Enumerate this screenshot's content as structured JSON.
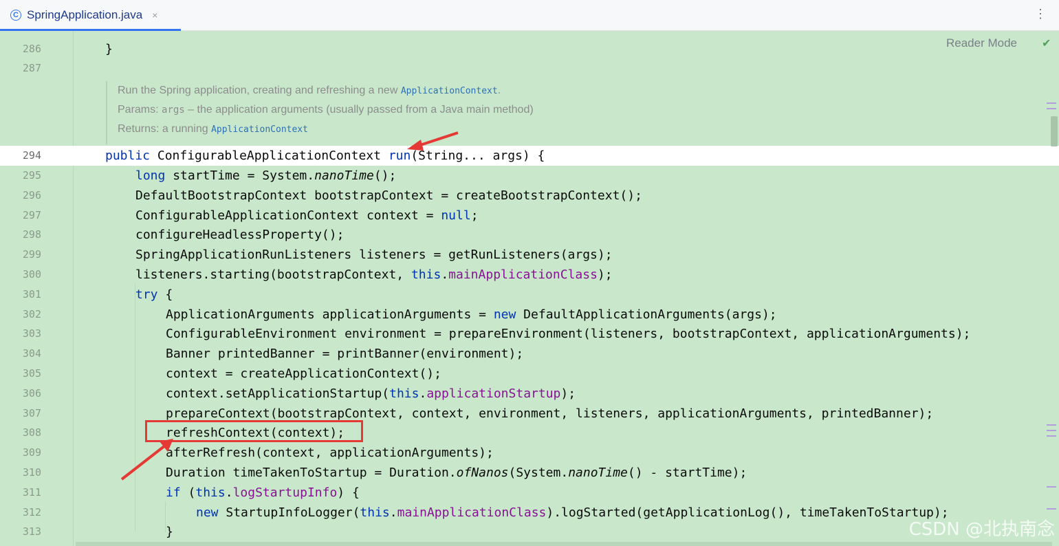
{
  "tab": {
    "label": "SpringApplication.java",
    "icon_letter": "C",
    "close": "×"
  },
  "toolbar": {
    "reader_mode": "Reader Mode",
    "menu": "⋮",
    "check": "✔"
  },
  "doc": {
    "line1_text": "Run the Spring application, creating and refreshing a new ",
    "line1_code": "ApplicationContext",
    "line1_end": ".",
    "line2_label": "Params: ",
    "line2_code": "args",
    "line2_text": " – the application arguments (usually passed from a Java main method)",
    "line3_label": "Returns: a running ",
    "line3_code": "ApplicationContext"
  },
  "lines": [
    {
      "n": "286",
      "t": "}"
    },
    {
      "n": "287",
      "t": ""
    },
    {
      "n": "294",
      "t": "public ConfigurableApplicationContext run(String... args) {"
    },
    {
      "n": "295",
      "t": "long startTime = System.nanoTime();"
    },
    {
      "n": "296",
      "t": "DefaultBootstrapContext bootstrapContext = createBootstrapContext();"
    },
    {
      "n": "297",
      "t": "ConfigurableApplicationContext context = null;"
    },
    {
      "n": "298",
      "t": "configureHeadlessProperty();"
    },
    {
      "n": "299",
      "t": "SpringApplicationRunListeners listeners = getRunListeners(args);"
    },
    {
      "n": "300",
      "t": "listeners.starting(bootstrapContext, this.mainApplicationClass);"
    },
    {
      "n": "301",
      "t": "try {"
    },
    {
      "n": "302",
      "t": "ApplicationArguments applicationArguments = new DefaultApplicationArguments(args);"
    },
    {
      "n": "303",
      "t": "ConfigurableEnvironment environment = prepareEnvironment(listeners, bootstrapContext, applicationArguments);"
    },
    {
      "n": "304",
      "t": "Banner printedBanner = printBanner(environment);"
    },
    {
      "n": "305",
      "t": "context = createApplicationContext();"
    },
    {
      "n": "306",
      "t": "context.setApplicationStartup(this.applicationStartup);"
    },
    {
      "n": "307",
      "t": "prepareContext(bootstrapContext, context, environment, listeners, applicationArguments, printedBanner);"
    },
    {
      "n": "308",
      "t": "refreshContext(context);"
    },
    {
      "n": "309",
      "t": "afterRefresh(context, applicationArguments);"
    },
    {
      "n": "310",
      "t": "Duration timeTakenToStartup = Duration.ofNanos(System.nanoTime() - startTime);"
    },
    {
      "n": "311",
      "t": "if (this.logStartupInfo) {"
    },
    {
      "n": "312",
      "t": "new StartupInfoLogger(this.mainApplicationClass).logStarted(getApplicationLog(), timeTakenToStartup);"
    },
    {
      "n": "313",
      "t": "}"
    }
  ],
  "watermark": "CSDN @北执南念",
  "colors": {
    "editor_bg": "#c9e8cb",
    "keyword": "#0033b3",
    "field": "#871094",
    "annotation_red": "#e53935"
  }
}
